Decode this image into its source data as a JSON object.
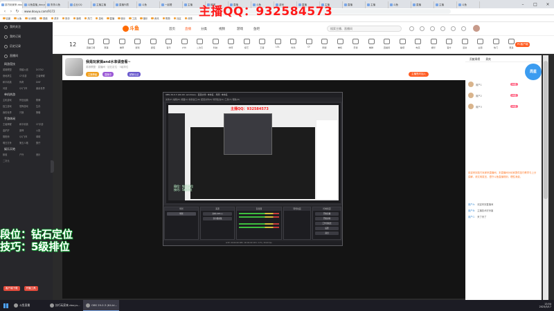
{
  "browser": {
    "tabs": [
      "技巧玩家来.douyu...",
      "斗鱼直播_douyu...",
      "鲁鲁斗鱼",
      "企业QQ",
      "主播主播",
      "直播列表",
      "斗鱼",
      "一起看",
      "主播",
      "组团",
      "直播",
      "斗鱼",
      "游戏",
      "直播",
      "主播",
      "直播",
      "主播",
      "斗鱼",
      "直播",
      "主播",
      "斗鱼"
    ],
    "active_tab_index": 0,
    "url": "www.douyu.com/9172",
    "bookmarks": [
      "百度",
      "斗鱼",
      "QQ邮箱",
      "视频",
      "虎牙",
      "快手",
      "新闻",
      "热门",
      "游戏",
      "直播",
      "音乐",
      "工具",
      "娱乐",
      "资讯",
      "购物",
      "社区",
      "体育"
    ],
    "controls": {
      "minimize": "–",
      "maximize": "□",
      "close": "×"
    }
  },
  "overlay": {
    "qq_banner": "主播QQ：932584573",
    "caption_line1": "段位：钻石定位",
    "caption_line2": "技巧：5级排位"
  },
  "sidebar": {
    "items": [
      "我的关注",
      "我的订阅",
      "历史记录",
      "直播间"
    ],
    "sections": [
      {
        "title": "网游竞技",
        "items": [
          "英雄联盟",
          "穿越火线",
          "DOTA2",
          "绝地求生",
          "CF手游",
          "王者荣耀",
          "和平精英",
          "传奇",
          "DNF",
          "问道",
          "QQ飞车",
          "魔兽世界"
        ]
      },
      {
        "title": "单机热游",
        "items": [
          "主机游戏",
          "怀旧经典",
          "棋牌",
          "独立游戏",
          "恐怖游戏",
          "生存",
          "我的世界",
          "只狼",
          "策略"
        ]
      },
      {
        "title": "手游休闲",
        "items": [
          "王者荣耀",
          "和平精英",
          "CF手游",
          "金铲铲",
          "原神",
          "火影",
          "阴阳师",
          "QQ飞车",
          "球球",
          "明日方舟",
          "第五人格",
          "蛋仔"
        ]
      },
      {
        "title": "娱乐天地",
        "items": [
          "颜值",
          "户外",
          "音乐",
          "二次元"
        ]
      }
    ],
    "bottom_buttons": [
      "客户端下载",
      "开播工具"
    ]
  },
  "topnav": {
    "logo": "斗鱼",
    "links": [
      "首页",
      "直播",
      "分类",
      "视频",
      "游戏",
      "鱼吧"
    ],
    "active_link_index": 1,
    "search_placeholder": "搜索主播、直播间"
  },
  "categories": {
    "time_label": "12",
    "items": [
      "直播订阅",
      "赛事",
      "推荐",
      "游戏",
      "颜值",
      "音乐",
      "户外",
      "二次元",
      "科技",
      "体育",
      "综艺",
      "王者",
      "LOL",
      "吃鸡",
      "CF",
      "网游",
      "单机",
      "手游",
      "棋牌",
      "直播间",
      "鱼吧",
      "电竞",
      "娱乐",
      "官方",
      "活动",
      "主题",
      "热门",
      "更多"
    ],
    "pc_button": "PC客户端"
  },
  "room": {
    "title": "我是玩家搞and水准请查看~",
    "subtitle": "英雄联盟 · 直播间 · 钻石定位 · 5级排位",
    "tags": [
      "主播等级",
      "直播中",
      "超管认证"
    ],
    "action": "主播签约加入"
  },
  "obs": {
    "title": "OBS 29.0.3 (64-bit, windows) - 配置文件: 未命名 - 场景: 未命名",
    "menu": "文件(F)  编辑(E)  视图(V)  停靠窗口(D)  配置文件(P)  场景集合(S)  工具(T)  帮助(H)",
    "docks": [
      "场景",
      "来源",
      "混音器",
      "转场动画",
      "控制按钮"
    ],
    "sources": [
      "场景",
      "文本 (GDI+)",
      "显示器采集"
    ],
    "controls": [
      "开始直播",
      "开始录制",
      "工作室模式",
      "设置",
      "退出"
    ],
    "status": "LIVE: 00:00:00   REC: 00:00:00   CPU: 2.3%, 30.00 fps"
  },
  "chat": {
    "tabs": [
      "贡献周榜",
      "贵宾"
    ],
    "badge": "周星",
    "ranks": [
      {
        "name": "用户1",
        "level": "30级"
      },
      {
        "name": "用户2",
        "level": "28级"
      },
      {
        "name": "用户3",
        "level": "25级"
      }
    ],
    "notice": "欢迎来到技巧玩家来直播间，本直播间为玩家提供技巧教学与上分讲解，请文明发言，遵守斗鱼直播规则，理性消费。",
    "messages": [
      {
        "user": "用户A",
        "text": "欢迎来到直播间"
      },
      {
        "user": "用户B",
        "text": "主播技术好厉害"
      },
      {
        "user": "用户C",
        "text": "来了来了"
      }
    ]
  },
  "taskbar": {
    "apps": [
      "斗鱼直播",
      "技巧玩家来.douyu...",
      "OBS 29.0.3 (64-bi..."
    ],
    "active_index": 2,
    "time": "13:54",
    "date": "2023/3/17"
  }
}
